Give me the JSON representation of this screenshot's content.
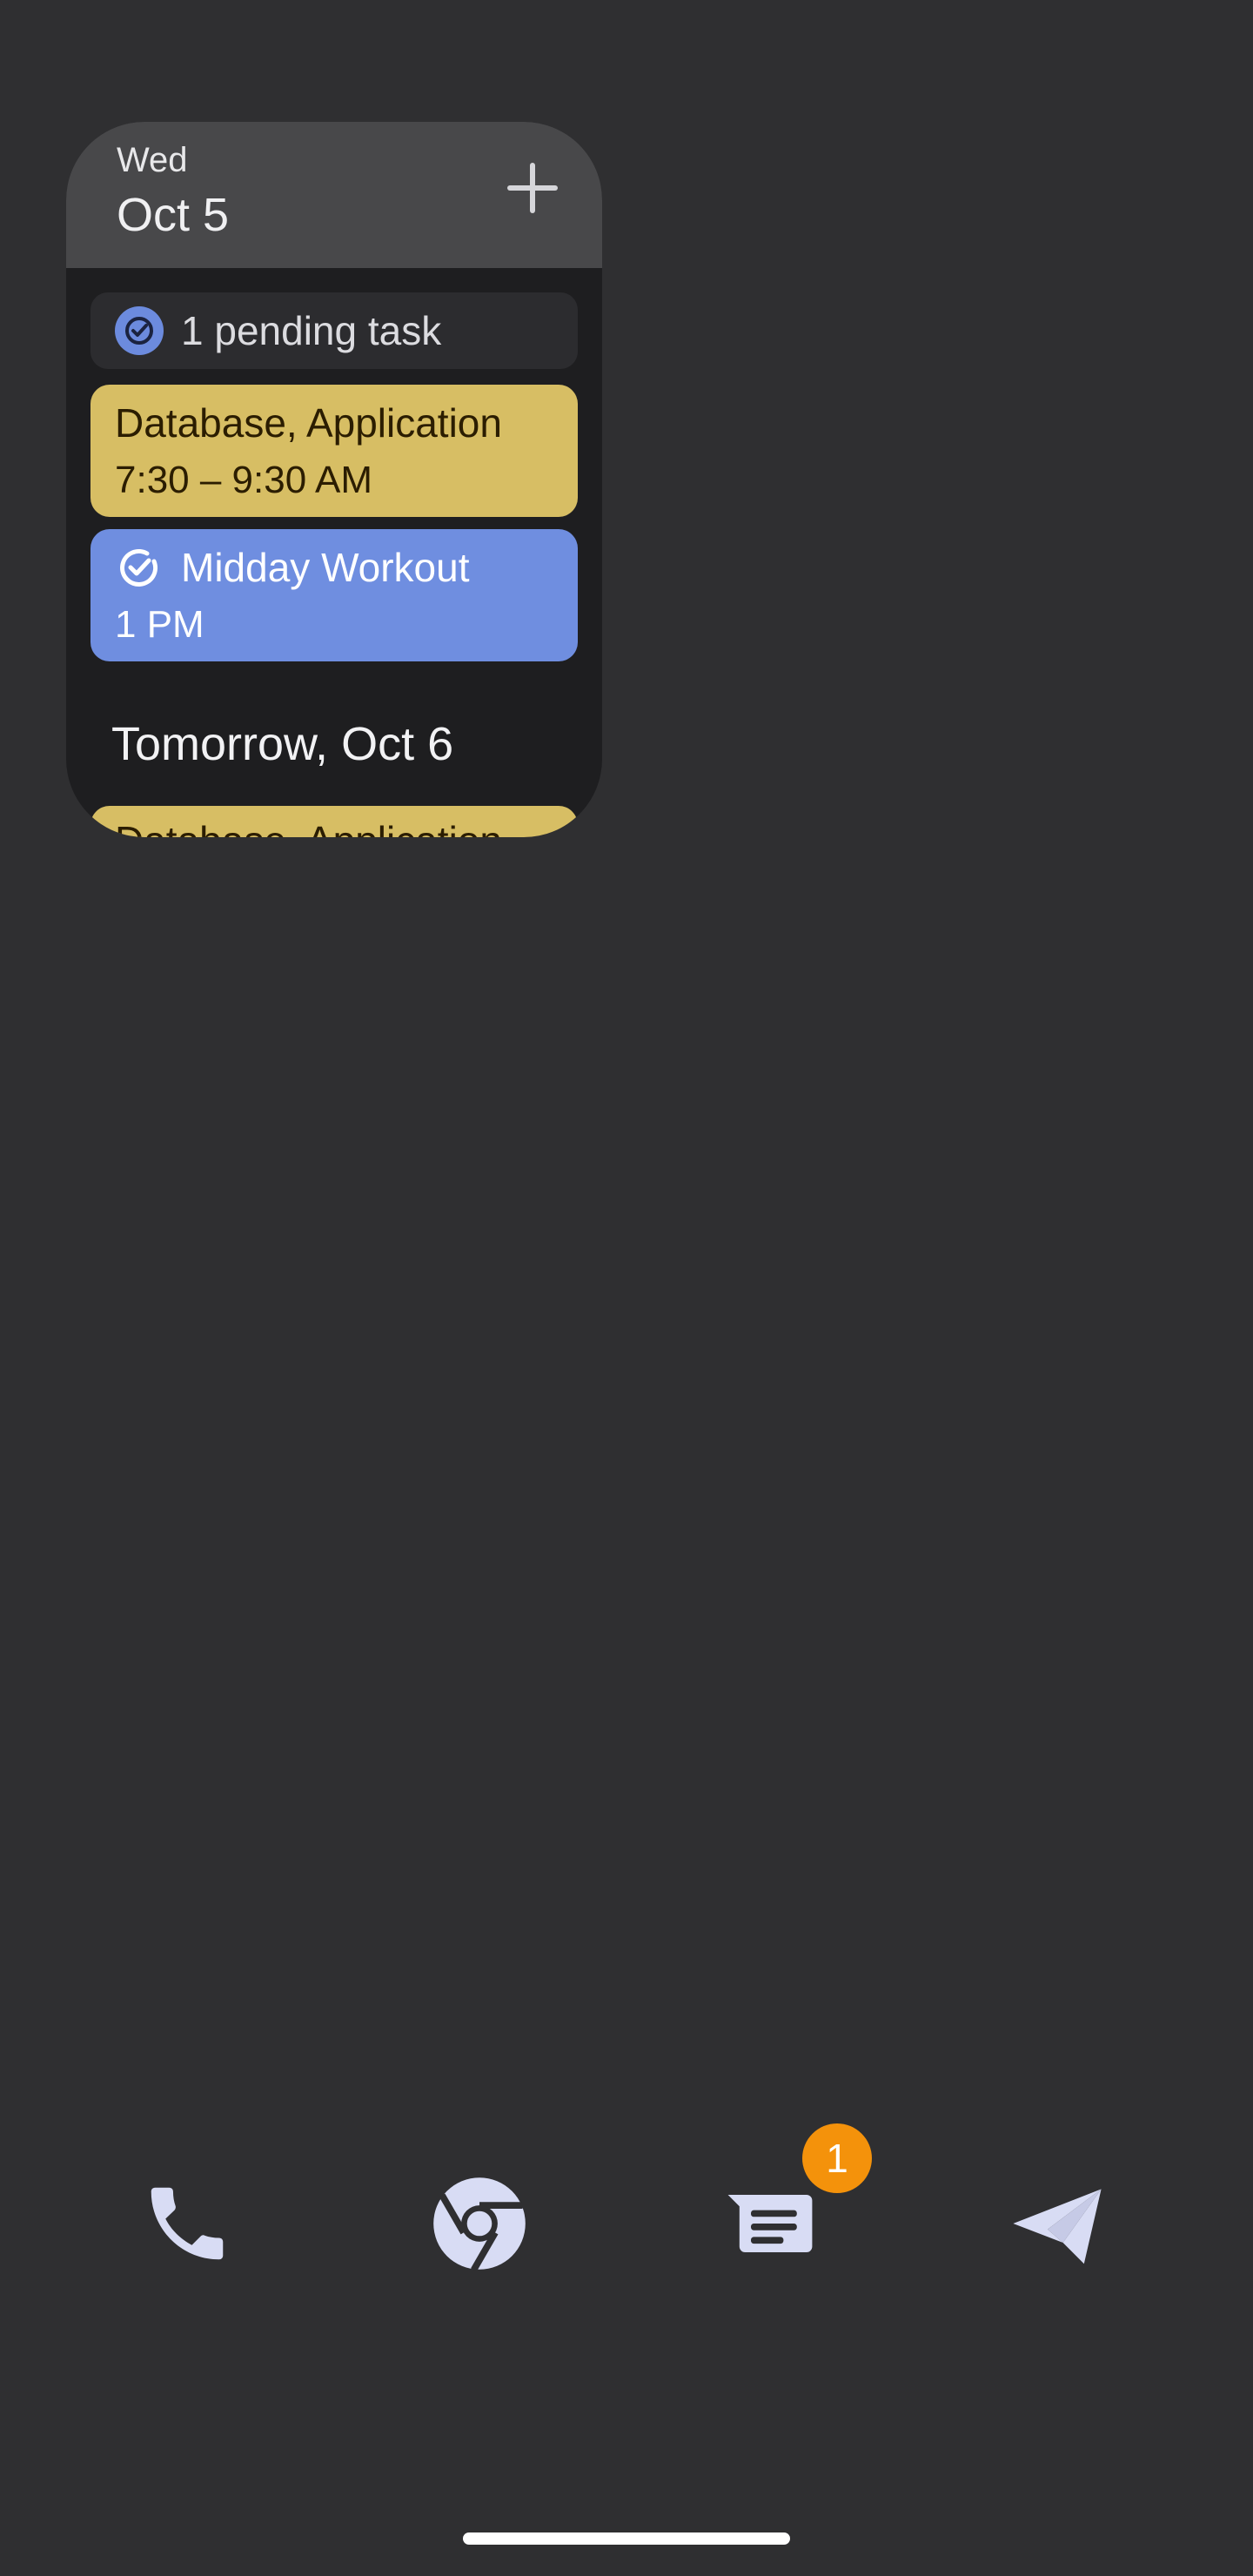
{
  "widget": {
    "weekday": "Wed",
    "date": "Oct 5",
    "pending_tasks": "1 pending task",
    "events_today": [
      {
        "title": "Database, Application",
        "time": "7:30 – 9:30 AM",
        "color": "#d7be64"
      },
      {
        "title": "Midday Workout",
        "time": "1 PM",
        "color": "#6f8ee0"
      }
    ],
    "tomorrow_heading": "Tomorrow, Oct 6",
    "events_tomorrow": [
      {
        "title": "Database, Application",
        "color": "#d7be64"
      }
    ]
  },
  "dock": {
    "apps": [
      "phone-icon",
      "chrome-icon",
      "messages-icon",
      "send-icon"
    ],
    "messages_badge": "1",
    "badge_color": "#f4920b"
  }
}
